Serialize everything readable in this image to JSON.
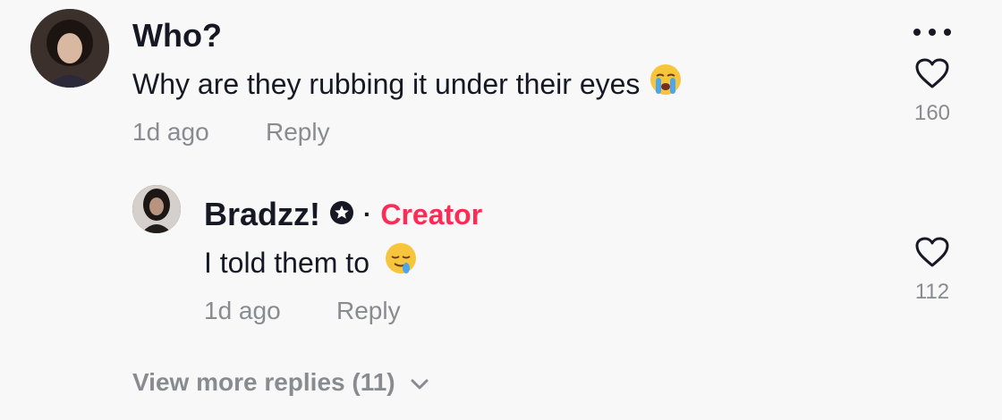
{
  "comments": [
    {
      "username": "Who?",
      "text": "Why are they rubbing it under their eyes",
      "emoji": "crying-face",
      "time": "1d ago",
      "reply_label": "Reply",
      "likes": "160"
    },
    {
      "username": "Bradzz!",
      "badge": "star-badge-icon",
      "creator_label": "Creator",
      "separator": "·",
      "text": "I told them to",
      "emoji": "drooling-face",
      "time": "1d ago",
      "reply_label": "Reply",
      "likes": "112"
    }
  ],
  "view_more_label": "View more replies (11)",
  "colors": {
    "text": "#161823",
    "meta": "#8a8b91",
    "creator": "#fe2c55",
    "background": "#f8f8f8"
  }
}
